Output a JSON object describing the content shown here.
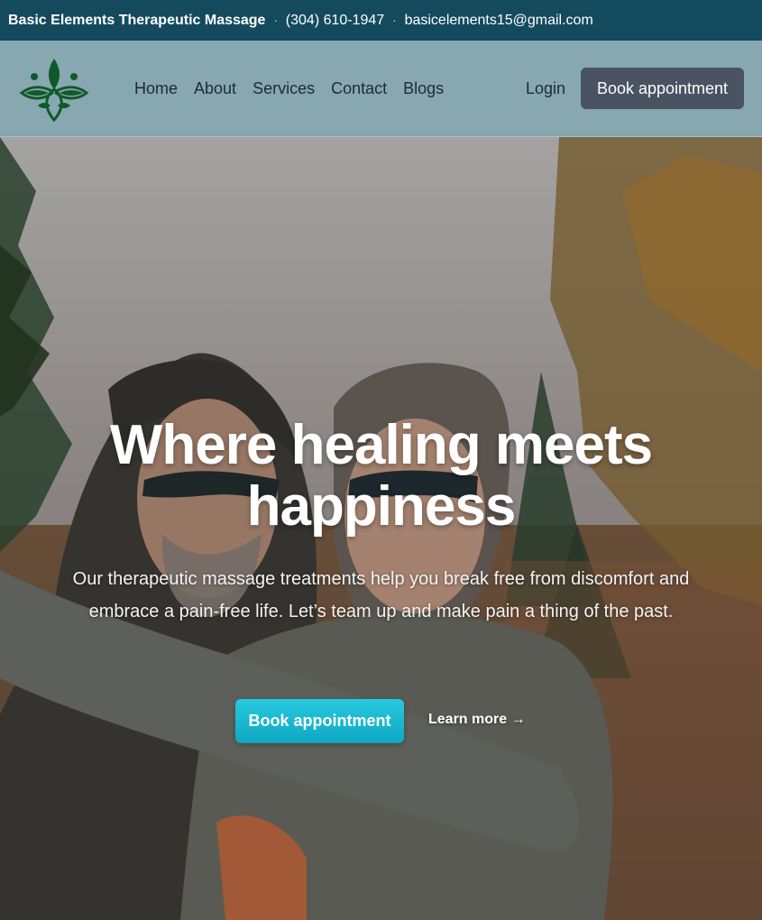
{
  "topbar": {
    "business_name": "Basic Elements Therapeutic Massage",
    "phone": "(304) 610-1947",
    "email": "basicelements15@gmail.com",
    "separator": "·",
    "background": "#144a5e"
  },
  "header": {
    "logo_icon": "lotus-leaf-logo",
    "nav": [
      {
        "label": "Home"
      },
      {
        "label": "About"
      },
      {
        "label": "Services"
      },
      {
        "label": "Contact"
      },
      {
        "label": "Blogs"
      }
    ],
    "login_label": "Login",
    "book_label": "Book appointment",
    "background": "#87a7b1",
    "book_button_color": "#4a5361"
  },
  "hero": {
    "title": "Where healing meets happiness",
    "subtitle": "Our therapeutic massage treatments help you break free from discomfort and embrace a pain-free life. Let’s team up and make pain a thing of the past.",
    "primary_button": "Book appointment",
    "secondary_link": "Learn more →",
    "accent_color": "#1bb8d1"
  }
}
